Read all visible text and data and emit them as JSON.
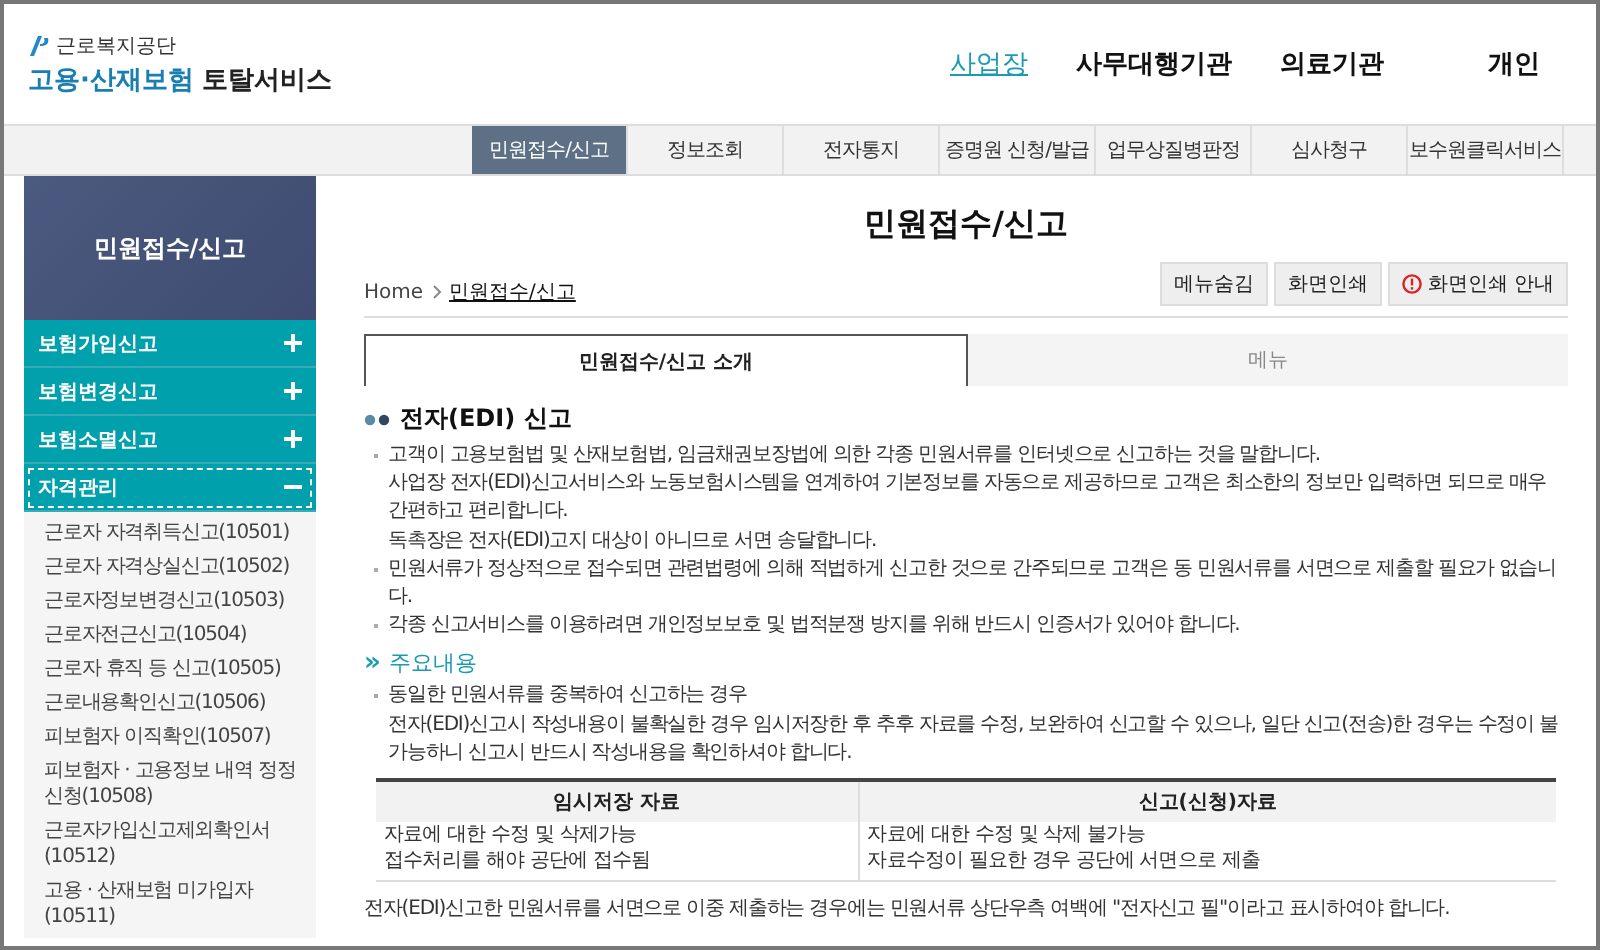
{
  "logo": {
    "org": "근로복지공단",
    "service_highlight": "고용·산재보험",
    "service_rest": "토탈서비스"
  },
  "top_nav": [
    {
      "label": "사업장",
      "selected": true
    },
    {
      "label": "사무대행기관",
      "selected": false
    },
    {
      "label": "의료기관",
      "selected": false
    },
    {
      "label": "개인",
      "selected": false
    }
  ],
  "main_nav": [
    {
      "label": "민원접수/신고",
      "selected": true
    },
    {
      "label": "정보조회",
      "selected": false
    },
    {
      "label": "전자통지",
      "selected": false
    },
    {
      "label": "증명원 신청/발급",
      "selected": false
    },
    {
      "label": "업무상질병판정",
      "selected": false
    },
    {
      "label": "심사청구",
      "selected": false
    },
    {
      "label": "보수원클릭서비스",
      "selected": false
    }
  ],
  "sidebar": {
    "title": "민원접수/신고",
    "sections": [
      {
        "label": "보험가입신고",
        "expanded": false
      },
      {
        "label": "보험변경신고",
        "expanded": false
      },
      {
        "label": "보험소멸신고",
        "expanded": false
      },
      {
        "label": "자격관리",
        "expanded": true,
        "children": [
          "근로자 자격취득신고(10501)",
          "근로자 자격상실신고(10502)",
          "근로자정보변경신고(10503)",
          "근로자전근신고(10504)",
          "근로자 휴직 등 신고(10505)",
          "근로내용확인신고(10506)",
          "피보험자 이직확인(10507)",
          "피보험자 · 고용정보 내역 정정 신청(10508)",
          "근로자가입신고제외확인서(10512)",
          "고용 · 산재보험 미가입자(10511)"
        ]
      }
    ]
  },
  "page_title": "민원접수/신고",
  "breadcrumb": [
    "Home",
    "민원접수/신고"
  ],
  "buttons": [
    {
      "label": "메뉴숨김",
      "kind": "plain"
    },
    {
      "label": "화면인쇄",
      "kind": "plain"
    },
    {
      "label": "화면인쇄 안내",
      "kind": "info"
    }
  ],
  "tabs": [
    {
      "label": "민원접수/신고 소개",
      "selected": true
    },
    {
      "label": "메뉴",
      "selected": false
    }
  ],
  "section_heading": "전자(EDI) 신고",
  "bullets": [
    {
      "lines": [
        "고객이 고용보험법 및 산재보험법, 임금채권보장법에 의한 각종 민원서류를 인터넷으로 신고하는 것을 말합니다.",
        "사업장 전자(EDI)신고서비스와 노동보험시스템을 연계하여 기본정보를 자동으로 제공하므로 고객은 최소한의 정보만 입력하면 되므로 매우 간편하고 편리합니다.",
        "독촉장은 전자(EDI)고지 대상이 아니므로 서면 송달합니다."
      ]
    },
    {
      "lines": [
        "민원서류가 정상적으로 접수되면 관련법령에 의해 적법하게 신고한 것으로 간주되므로 고객은 동 민원서류를 서면으로 제출할 필요가 없습니다."
      ]
    },
    {
      "lines": [
        "각종 신고서비스를 이용하려면 개인정보보호 및 법적분쟁 방지를 위해 반드시 인증서가 있어야 합니다."
      ]
    }
  ],
  "subheading": {
    "marker": "»",
    "text": "주요내용"
  },
  "sub_bullets": [
    {
      "lines": [
        "동일한 민원서류를 중복하여 신고하는 경우",
        "전자(EDI)신고시 작성내용이 불확실한 경우 임시저장한 후 추후 자료를 수정, 보완하여 신고할 수 있으나, 일단 신고(전송)한 경우는 수정이 불가능하니 신고시 반드시 작성내용을 확인하셔야 합니다."
      ]
    }
  ],
  "table": {
    "columns": [
      "임시저장 자료",
      "신고(신청)자료"
    ],
    "rows": [
      [
        "자료에 대한 수정 및 삭제가능",
        "자료에 대한 수정 및 삭제 불가능"
      ],
      [
        "접수처리를 해야 공단에 접수됨",
        "자료수정이 필요한 경우 공단에 서면으로 제출"
      ]
    ]
  },
  "note": "전자(EDI)신고한 민원서류를 서면으로 이중 제출하는 경우에는 민원서류 상단우측 여백에 \"전자신고 필\"이라고 표시하여야 합니다."
}
